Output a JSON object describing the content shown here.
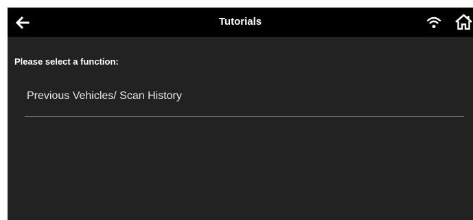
{
  "header": {
    "title": "Tutorials",
    "back_icon": "arrow-left-icon",
    "wifi_icon": "wifi-icon",
    "home_icon": "home-icon"
  },
  "main": {
    "prompt": "Please select a function:",
    "items": [
      {
        "label": "Previous Vehicles/ Scan History"
      }
    ]
  },
  "colors": {
    "header_bg": "#000000",
    "screen_bg": "#222222",
    "text": "#ffffff",
    "divider": "#6b6b6b"
  }
}
